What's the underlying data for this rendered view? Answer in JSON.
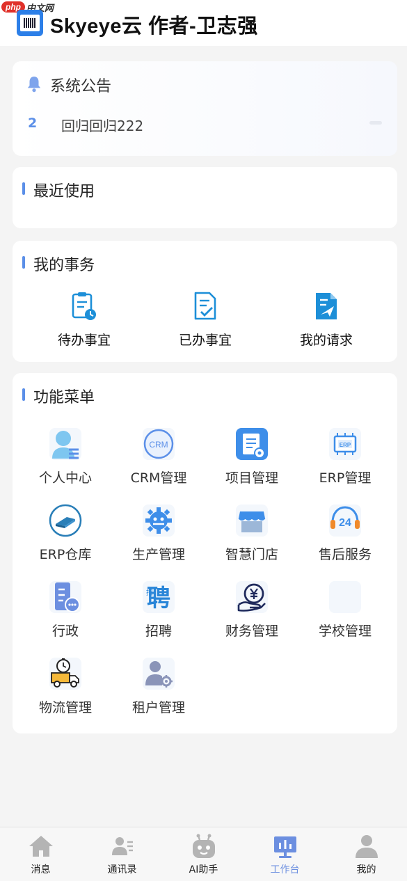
{
  "watermark": {
    "badge": "php",
    "text": "中文网"
  },
  "header": {
    "title": "Skyeye云 作者-卫志强"
  },
  "notice": {
    "title": "系统公告",
    "items": [
      {
        "num": "2",
        "text": "回归回归222"
      }
    ]
  },
  "recent": {
    "title": "最近使用"
  },
  "affairs": {
    "title": "我的事务",
    "items": [
      {
        "label": "待办事宜"
      },
      {
        "label": "已办事宜"
      },
      {
        "label": "我的请求"
      }
    ]
  },
  "menu": {
    "title": "功能菜单",
    "items": [
      {
        "label": "个人中心"
      },
      {
        "label": "CRM管理"
      },
      {
        "label": "项目管理"
      },
      {
        "label": "ERP管理"
      },
      {
        "label": "ERP仓库"
      },
      {
        "label": "生产管理"
      },
      {
        "label": "智慧门店"
      },
      {
        "label": "售后服务"
      },
      {
        "label": "行政"
      },
      {
        "label": "招聘"
      },
      {
        "label": "财务管理"
      },
      {
        "label": "学校管理"
      },
      {
        "label": "物流管理"
      },
      {
        "label": "租户管理"
      }
    ],
    "icon_text": {
      "crm": "CRM",
      "erp": "ERP",
      "service": "24",
      "recruit": "聘",
      "recruit_small": "招"
    }
  },
  "tabbar": {
    "items": [
      {
        "label": "消息"
      },
      {
        "label": "通讯录"
      },
      {
        "label": "AI助手"
      },
      {
        "label": "工作台"
      },
      {
        "label": "我的"
      }
    ],
    "active": "工作台"
  },
  "colors": {
    "accent": "#5b8fe8",
    "active_tab": "#6c8fe0",
    "background": "#f4f4f4"
  }
}
